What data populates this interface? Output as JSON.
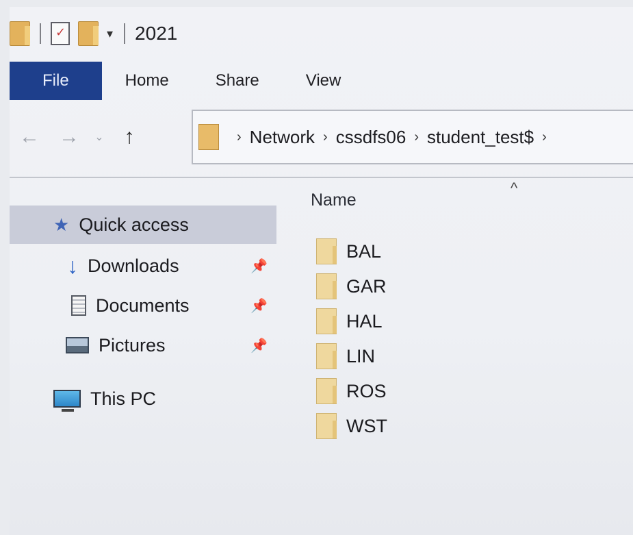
{
  "window": {
    "title": "2021"
  },
  "ribbon": {
    "tabs": [
      {
        "label": "File"
      },
      {
        "label": "Home"
      },
      {
        "label": "Share"
      },
      {
        "label": "View"
      }
    ]
  },
  "address": {
    "breadcrumbs": [
      "Network",
      "cssdfs06",
      "student_test$"
    ]
  },
  "navigation": {
    "quick_access": "Quick access",
    "downloads": "Downloads",
    "documents": "Documents",
    "pictures": "Pictures",
    "this_pc": "This PC"
  },
  "filelist": {
    "column_name": "Name",
    "folders": [
      "BAL",
      "GAR",
      "HAL",
      "LIN",
      "ROS",
      "WST"
    ]
  },
  "colors": {
    "file_tab": "#1e3f8c",
    "selected_nav": "#c9ccd9",
    "folder": "#efd89e"
  }
}
